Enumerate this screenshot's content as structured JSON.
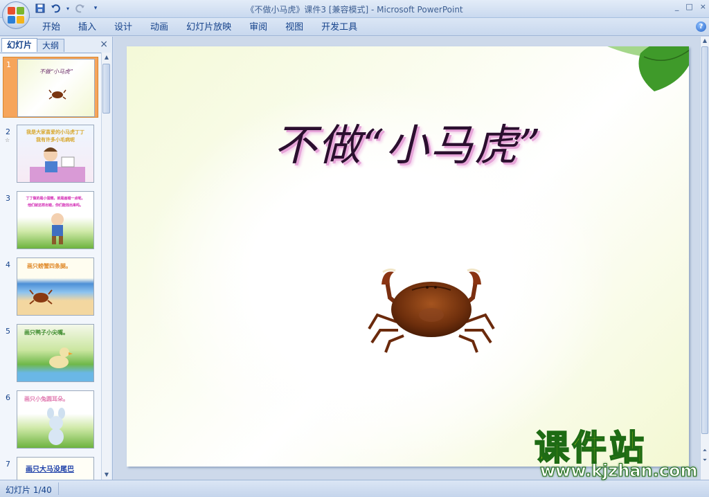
{
  "window": {
    "title": "《不做小马虎》课件3 [兼容模式] - Microsoft PowerPoint",
    "controls": [
      "_",
      "□",
      "×"
    ]
  },
  "quick_access": {
    "icons": [
      "save-icon",
      "undo-icon",
      "redo-icon",
      "customize-icon"
    ]
  },
  "ribbon": {
    "tabs": [
      "开始",
      "插入",
      "设计",
      "动画",
      "幻灯片放映",
      "审阅",
      "视图",
      "开发工具"
    ],
    "help": "?"
  },
  "left_pane": {
    "tabs": [
      "幻灯片",
      "大纲"
    ],
    "close": "×",
    "slides": [
      {
        "number": "1",
        "text": "不做“小马虎”",
        "selected": true
      },
      {
        "number": "2",
        "text": "我是大家喜爱的小马虎丁丁",
        "subtext": "我有许多小毛病呢",
        "extra": "1"
      },
      {
        "number": "3",
        "text": "丁丁做的是小蛋糕，就是画错一点呢。",
        "subtext": "他们就这样出错，你们能找出来吗。"
      },
      {
        "number": "4",
        "text": "画只螃蟹四条腿。"
      },
      {
        "number": "5",
        "text": "画只鸭子小尖嘴。"
      },
      {
        "number": "6",
        "text": "画只小兔圆耳朵。"
      },
      {
        "number": "7",
        "text": "画只大马没尾巴"
      }
    ]
  },
  "slide": {
    "title": "不做“小马虎”"
  },
  "watermark": {
    "title": "课件站",
    "url": "www.kjzhan.com"
  },
  "status": {
    "slide_info": "幻灯片 1/40"
  },
  "colors": {
    "ribbon_text": "#15428b",
    "selected_thumb": "#f6a55b",
    "title_shadow": "#e6a4d8",
    "watermark_yellow": "#f7e80a",
    "watermark_green": "#1e6b14"
  }
}
